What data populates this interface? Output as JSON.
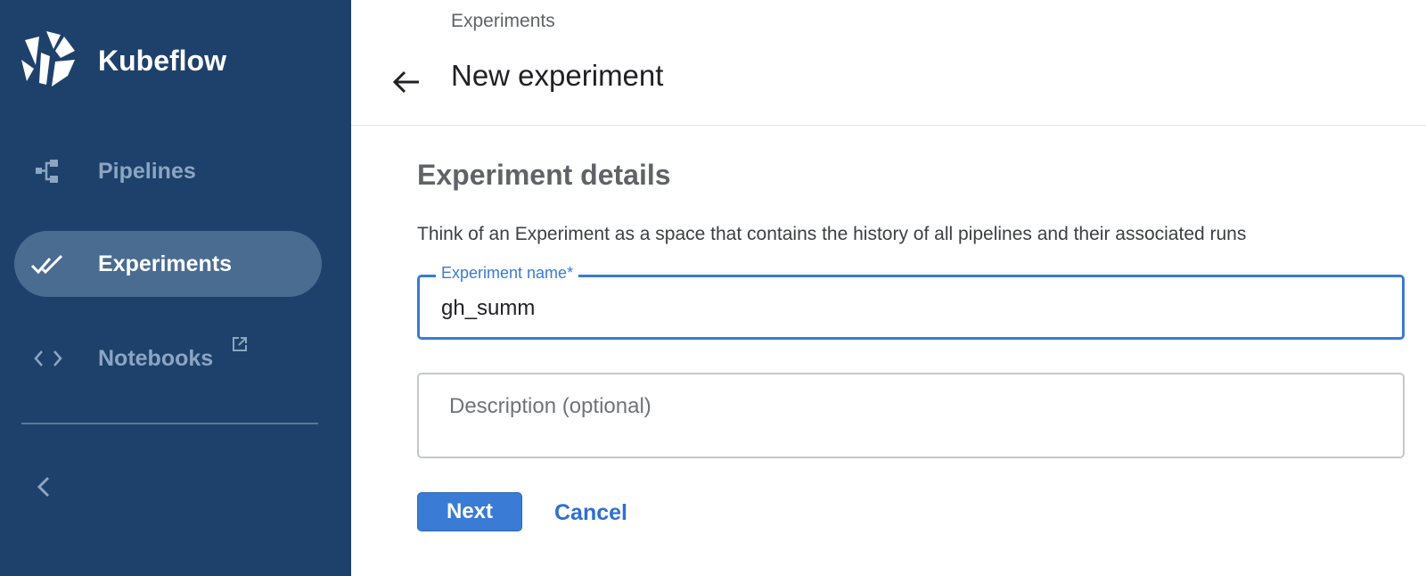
{
  "app": {
    "name": "Kubeflow",
    "logo_icon": "kubeflow-logo-icon"
  },
  "sidebar": {
    "items": [
      {
        "label": "Pipelines",
        "icon": "pipelines-icon",
        "active": false
      },
      {
        "label": "Experiments",
        "icon": "double-check-icon",
        "active": true
      },
      {
        "label": "Notebooks",
        "icon": "code-brackets-icon",
        "active": false,
        "external": true
      }
    ],
    "collapse_icon": "chevron-left-icon"
  },
  "header": {
    "breadcrumb": "Experiments",
    "title": "New experiment",
    "back_icon": "arrow-left-icon"
  },
  "form": {
    "section_title": "Experiment details",
    "section_description": "Think of an Experiment as a space that contains the history of all pipelines and their associated runs",
    "name_field": {
      "label": "Experiment name*",
      "value": "gh_summ"
    },
    "description_field": {
      "placeholder": "Description (optional)",
      "value": ""
    },
    "next_label": "Next",
    "cancel_label": "Cancel"
  },
  "colors": {
    "sidebar_bg": "#1e416b",
    "active_item_bg": "#4a6c91",
    "accent": "#3a7bd5"
  }
}
